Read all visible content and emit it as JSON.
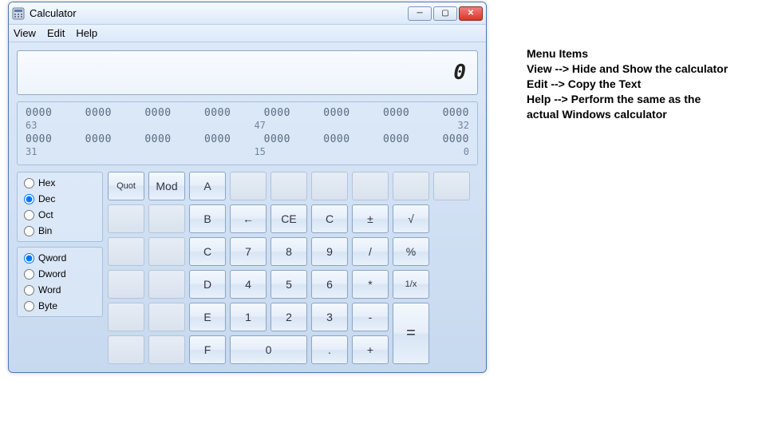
{
  "window": {
    "title": "Calculator",
    "minimize_glyph": "─",
    "maximize_glyph": "▢",
    "close_glyph": "✕"
  },
  "menubar": {
    "view": "View",
    "edit": "Edit",
    "help": "Help"
  },
  "display": {
    "value": "0"
  },
  "bits": {
    "group": "0000",
    "labels": {
      "b63": "63",
      "b47": "47",
      "b32": "32",
      "b31": "31",
      "b15": "15",
      "b0": "0"
    }
  },
  "base": {
    "hex": "Hex",
    "dec": "Dec",
    "oct": "Oct",
    "bin": "Bin",
    "selected": "dec"
  },
  "word": {
    "qword": "Qword",
    "dword": "Dword",
    "word": "Word",
    "byte": "Byte",
    "selected": "qword"
  },
  "keys": {
    "quot": "Quot",
    "mod": "Mod",
    "a": "A",
    "b": "B",
    "c": "C",
    "d": "D",
    "e": "E",
    "f": "F",
    "back": "←",
    "ce": "CE",
    "clr": "C",
    "pm": "±",
    "sqrt": "√",
    "n7": "7",
    "n8": "8",
    "n9": "9",
    "div": "/",
    "pct": "%",
    "n4": "4",
    "n5": "5",
    "n6": "6",
    "mul": "*",
    "inv": "1/x",
    "n1": "1",
    "n2": "2",
    "n3": "3",
    "sub": "-",
    "n0": "0",
    "dot": ".",
    "add": "+",
    "eq": "="
  },
  "annotations": {
    "title": "Menu Items",
    "line1": "View --> Hide and Show the calculator",
    "line2": "Edit --> Copy the Text",
    "line3": "Help --> Perform the same as the",
    "line4": "actual Windows calculator"
  }
}
